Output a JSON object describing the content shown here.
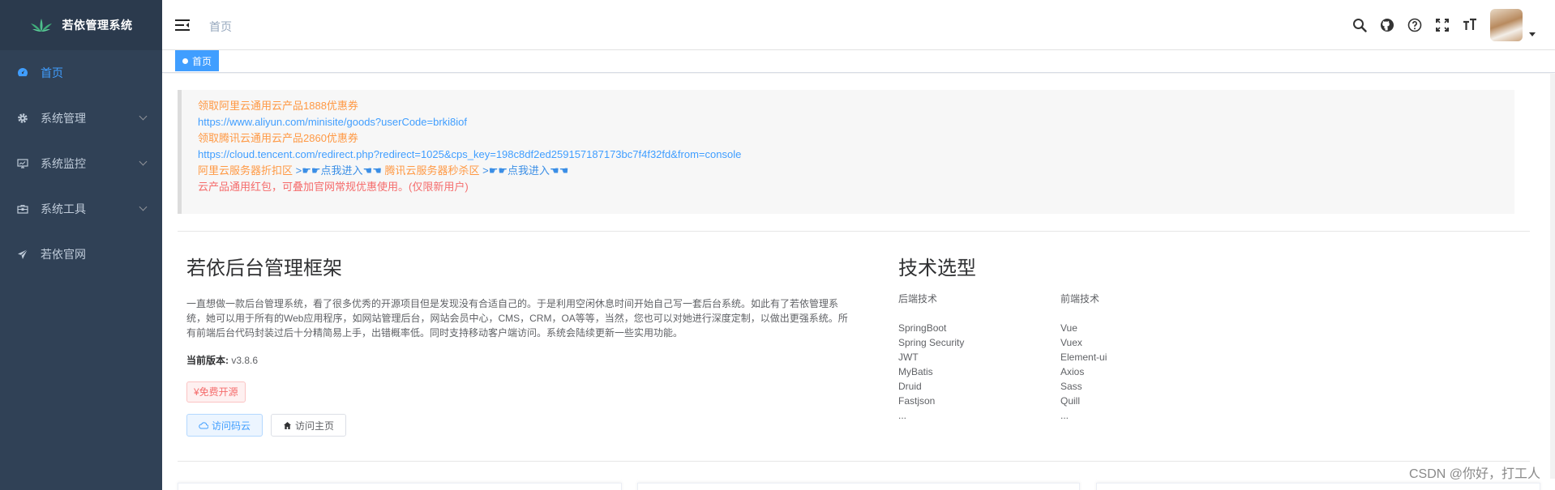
{
  "sidebar": {
    "logo_text": "若依管理系统",
    "items": [
      {
        "label": "首页",
        "icon": "dashboard-icon",
        "active": true
      },
      {
        "label": "系统管理",
        "icon": "gear-icon",
        "active": false
      },
      {
        "label": "系统监控",
        "icon": "monitor-icon",
        "active": false
      },
      {
        "label": "系统工具",
        "icon": "toolbox-icon",
        "active": false
      },
      {
        "label": "若依官网",
        "icon": "send-icon",
        "active": false
      }
    ]
  },
  "navbar": {
    "breadcrumb": "首页",
    "icons": [
      "search-icon",
      "github-icon",
      "help-icon",
      "fullscreen-icon",
      "font-size-icon"
    ]
  },
  "tags": {
    "active_tag": "首页"
  },
  "notice": {
    "line1": "领取阿里云通用云产品1888优惠券",
    "line2": "https://www.aliyun.com/minisite/goods?userCode=brki8iof",
    "line3": "领取腾讯云通用云产品2860优惠券",
    "line4": "https://cloud.tencent.com/redirect.php?redirect=1025&cps_key=198c8df2ed259157187173bc7f4f32fd&from=console",
    "line5a": "阿里云服务器折扣区",
    "line5b": ">☛☛点我进入☚☚",
    "line5c": "腾讯云服务器秒杀区",
    "line5d": ">☛☛点我进入☚☚",
    "line6": "云产品通用红包，可叠加官网常规优惠使用。(仅限新用户)"
  },
  "intro": {
    "title": "若依后台管理框架",
    "description": "一直想做一款后台管理系统，看了很多优秀的开源项目但是发现没有合适自己的。于是利用空闲休息时间开始自己写一套后台系统。如此有了若依管理系统，她可以用于所有的Web应用程序，如网站管理后台，网站会员中心，CMS，CRM，OA等等，当然，您也可以对她进行深度定制，以做出更强系统。所有前端后台代码封装过后十分精简易上手，出错概率低。同时支持移动客户端访问。系统会陆续更新一些实用功能。",
    "version_label": "当前版本:",
    "version_value": "v3.8.6",
    "badge": "¥免费开源",
    "btn_gitee": "访问码云",
    "btn_home": "访问主页"
  },
  "tech": {
    "title": "技术选型",
    "backend_header": "后端技术",
    "frontend_header": "前端技术",
    "backend": [
      "SpringBoot",
      "Spring Security",
      "JWT",
      "MyBatis",
      "Druid",
      "Fastjson",
      "..."
    ],
    "frontend": [
      "Vue",
      "Vuex",
      "Element-ui",
      "Axios",
      "Sass",
      "Quill",
      "..."
    ]
  },
  "watermark": "CSDN @你好，打工人"
}
